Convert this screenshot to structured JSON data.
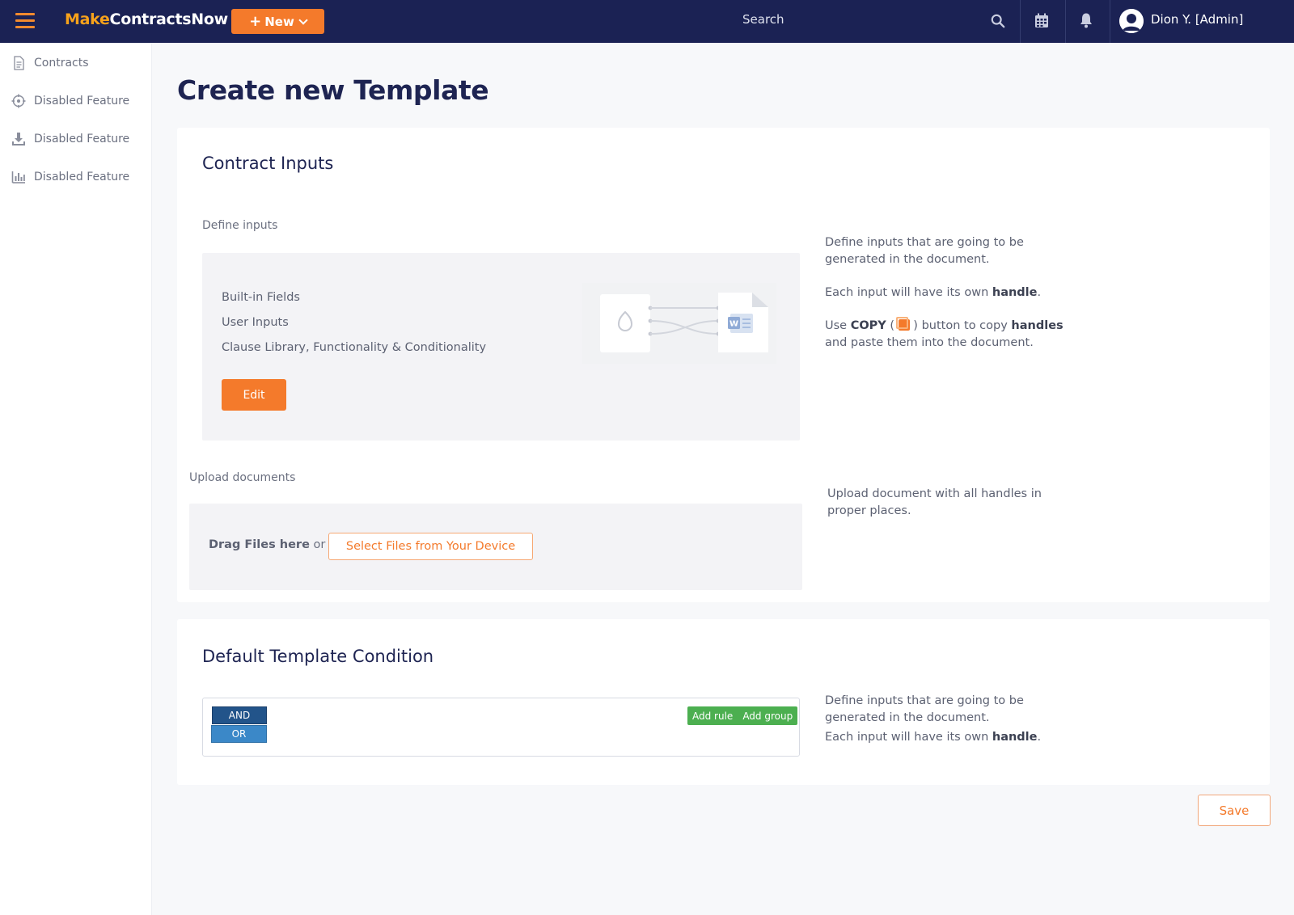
{
  "app": {
    "logo_m": "M",
    "logo_ake": "ake",
    "logo_rest": "ContractsNow",
    "new_label": "New",
    "search_placeholder": "Search",
    "user_name": "Dion Y. [Admin]"
  },
  "sidebar": {
    "items": [
      {
        "label": "Contracts",
        "icon": "document-icon"
      },
      {
        "label": "Disabled Feature",
        "icon": "crosshair-icon"
      },
      {
        "label": "Disabled Feature",
        "icon": "download-icon"
      },
      {
        "label": "Disabled Feature",
        "icon": "bar-chart-icon"
      }
    ]
  },
  "page": {
    "title": "Create new Template"
  },
  "contract_inputs": {
    "title": "Contract Inputs",
    "define_label": "Define inputs",
    "fields": [
      "Built-in Fields",
      "User Inputs",
      "Clause Library, Functionality & Conditionality"
    ],
    "edit_label": "Edit",
    "help1_line1": "Define inputs that are going to be",
    "help1_line2": "generated in the document.",
    "help2_pre": "Each input will have its own ",
    "help2_bold": "handle",
    "help2_post": ".",
    "help3_pre": "Use ",
    "help3_copy": "COPY",
    "help3_open": " ( ",
    "help3_close": " ) button to copy ",
    "help3_bold": "handles",
    "help3_line2": "and paste them into the document.",
    "upload_label": "Upload documents",
    "drag_bold": "Drag Files here",
    "drag_or": " or",
    "select_label": "Select Files from Your Device",
    "upload_help_line1": "Upload document with all handles in",
    "upload_help_line2": "proper places."
  },
  "condition": {
    "title": "Default Template Condition",
    "and_label": "AND",
    "or_label": "OR",
    "add_rule": "Add rule",
    "add_group": "Add group",
    "help_line1": "Define inputs that are going to be",
    "help_line2": "generated in the document.",
    "help_line3_pre": "Each input will have its own ",
    "help_line3_bold": "handle",
    "help_line3_post": "."
  },
  "actions": {
    "save_label": "Save"
  },
  "colors": {
    "topbar": "#1b2254",
    "accent": "#f47a2b",
    "logo_orange": "#f7a21b",
    "success": "#4caf50"
  }
}
